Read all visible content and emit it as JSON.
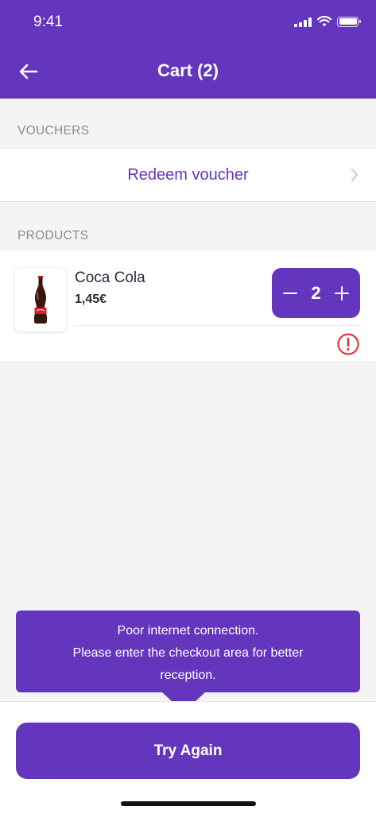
{
  "status_bar": {
    "time": "9:41"
  },
  "header": {
    "title": "Cart (2)",
    "back_icon": "arrow-left-icon"
  },
  "vouchers": {
    "section_label": "VOUCHERS",
    "redeem_label": "Redeem voucher"
  },
  "products": {
    "section_label": "PRODUCTS",
    "items": [
      {
        "name": "Coca Cola",
        "price": "1,45€",
        "quantity": "2",
        "status_icon": "alert-circle-icon"
      }
    ]
  },
  "tooltip": {
    "line1": "Poor internet connection.",
    "line2": "Please enter the checkout area for better",
    "line3": "reception."
  },
  "footer": {
    "try_again_label": "Try Again"
  },
  "colors": {
    "brand": "#6435bd",
    "alert": "#e03a3a",
    "background": "#f4f4f4"
  }
}
